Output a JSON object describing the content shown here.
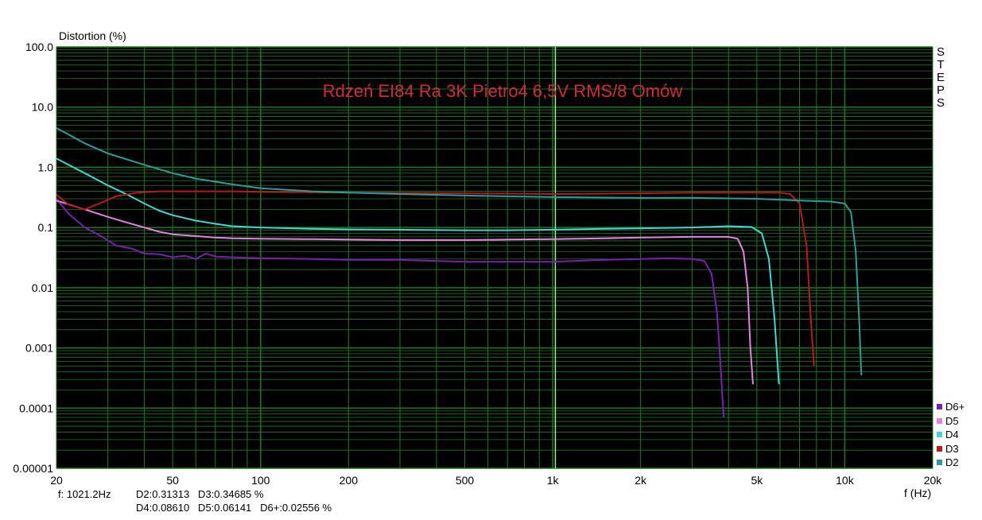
{
  "chart_data": {
    "type": "line",
    "title": "Rdzeń EI84 Ra 3K Pietro4  6,5V RMS/8 Omów",
    "ylabel": "Distortion (%)",
    "xlabel": "f (Hz)",
    "xscale": "log",
    "yscale": "log",
    "xlim": [
      20,
      20000
    ],
    "ylim": [
      1e-05,
      100
    ],
    "x_ticks": [
      {
        "v": 20,
        "label": "20"
      },
      {
        "v": 50,
        "label": "50"
      },
      {
        "v": 100,
        "label": "100"
      },
      {
        "v": 200,
        "label": "200"
      },
      {
        "v": 500,
        "label": "500"
      },
      {
        "v": 1000,
        "label": "1k"
      },
      {
        "v": 2000,
        "label": "2k"
      },
      {
        "v": 5000,
        "label": "5k"
      },
      {
        "v": 10000,
        "label": "10k"
      },
      {
        "v": 20000,
        "label": "20k"
      }
    ],
    "y_ticks": [
      {
        "v": 100,
        "label": "100.0"
      },
      {
        "v": 10,
        "label": "10.0"
      },
      {
        "v": 1,
        "label": "1.0"
      },
      {
        "v": 0.1,
        "label": "0.1"
      },
      {
        "v": 0.01,
        "label": "0.01"
      },
      {
        "v": 0.001,
        "label": "0.001"
      },
      {
        "v": 0.0001,
        "label": "0.0001"
      },
      {
        "v": 1e-05,
        "label": "0.00001"
      }
    ],
    "grid": true,
    "background": "#000000",
    "grid_color": "#1f7a1f",
    "cursor_x": 1021.2,
    "legend_placement": "right-bottom",
    "series": [
      {
        "name": "D6+",
        "color": "#7a1fb5",
        "points": [
          [
            20,
            0.3
          ],
          [
            22,
            0.17
          ],
          [
            25,
            0.1
          ],
          [
            28,
            0.075
          ],
          [
            32,
            0.05
          ],
          [
            36,
            0.045
          ],
          [
            40,
            0.037
          ],
          [
            45,
            0.036
          ],
          [
            50,
            0.032
          ],
          [
            55,
            0.034
          ],
          [
            60,
            0.03
          ],
          [
            65,
            0.037
          ],
          [
            70,
            0.033
          ],
          [
            80,
            0.032
          ],
          [
            100,
            0.031
          ],
          [
            150,
            0.03
          ],
          [
            200,
            0.029
          ],
          [
            300,
            0.029
          ],
          [
            500,
            0.027
          ],
          [
            700,
            0.027
          ],
          [
            1000,
            0.027
          ],
          [
            1500,
            0.029
          ],
          [
            2000,
            0.03
          ],
          [
            2500,
            0.031
          ],
          [
            3000,
            0.03
          ],
          [
            3300,
            0.028
          ],
          [
            3500,
            0.017
          ],
          [
            3650,
            0.004
          ],
          [
            3750,
            0.0006
          ],
          [
            3850,
            7e-05
          ]
        ]
      },
      {
        "name": "D5",
        "color": "#e680e6",
        "points": [
          [
            20,
            0.28
          ],
          [
            25,
            0.2
          ],
          [
            30,
            0.15
          ],
          [
            35,
            0.12
          ],
          [
            40,
            0.1
          ],
          [
            45,
            0.085
          ],
          [
            50,
            0.077
          ],
          [
            60,
            0.072
          ],
          [
            70,
            0.068
          ],
          [
            80,
            0.066
          ],
          [
            100,
            0.065
          ],
          [
            150,
            0.064
          ],
          [
            200,
            0.063
          ],
          [
            300,
            0.062
          ],
          [
            500,
            0.062
          ],
          [
            700,
            0.063
          ],
          [
            1000,
            0.064
          ],
          [
            1500,
            0.066
          ],
          [
            2000,
            0.068
          ],
          [
            3000,
            0.07
          ],
          [
            4000,
            0.07
          ],
          [
            4300,
            0.065
          ],
          [
            4500,
            0.04
          ],
          [
            4650,
            0.01
          ],
          [
            4750,
            0.001
          ],
          [
            4850,
            0.00025
          ]
        ]
      },
      {
        "name": "D4",
        "color": "#3fd6d6",
        "points": [
          [
            20,
            1.4
          ],
          [
            25,
            0.8
          ],
          [
            30,
            0.5
          ],
          [
            35,
            0.35
          ],
          [
            40,
            0.25
          ],
          [
            45,
            0.19
          ],
          [
            50,
            0.16
          ],
          [
            60,
            0.13
          ],
          [
            70,
            0.115
          ],
          [
            80,
            0.105
          ],
          [
            100,
            0.1
          ],
          [
            150,
            0.095
          ],
          [
            200,
            0.093
          ],
          [
            300,
            0.092
          ],
          [
            500,
            0.09
          ],
          [
            700,
            0.09
          ],
          [
            1000,
            0.092
          ],
          [
            1500,
            0.095
          ],
          [
            2000,
            0.097
          ],
          [
            3000,
            0.1
          ],
          [
            4000,
            0.105
          ],
          [
            4800,
            0.102
          ],
          [
            5200,
            0.08
          ],
          [
            5500,
            0.03
          ],
          [
            5750,
            0.003
          ],
          [
            5950,
            0.00025
          ]
        ]
      },
      {
        "name": "D3",
        "color": "#b81a1a",
        "points": [
          [
            20,
            0.35
          ],
          [
            22,
            0.24
          ],
          [
            25,
            0.2
          ],
          [
            28,
            0.25
          ],
          [
            32,
            0.33
          ],
          [
            38,
            0.38
          ],
          [
            45,
            0.4
          ],
          [
            60,
            0.4
          ],
          [
            80,
            0.4
          ],
          [
            100,
            0.39
          ],
          [
            200,
            0.38
          ],
          [
            500,
            0.37
          ],
          [
            1000,
            0.36
          ],
          [
            2000,
            0.37
          ],
          [
            3000,
            0.38
          ],
          [
            4000,
            0.38
          ],
          [
            5000,
            0.38
          ],
          [
            6000,
            0.38
          ],
          [
            6500,
            0.36
          ],
          [
            7000,
            0.25
          ],
          [
            7400,
            0.05
          ],
          [
            7650,
            0.003
          ],
          [
            7850,
            0.0005
          ]
        ]
      },
      {
        "name": "D2",
        "color": "#2a9d9d",
        "points": [
          [
            20,
            4.5
          ],
          [
            25,
            2.5
          ],
          [
            30,
            1.7
          ],
          [
            40,
            1.1
          ],
          [
            50,
            0.8
          ],
          [
            60,
            0.65
          ],
          [
            80,
            0.52
          ],
          [
            100,
            0.45
          ],
          [
            150,
            0.4
          ],
          [
            200,
            0.38
          ],
          [
            300,
            0.36
          ],
          [
            500,
            0.34
          ],
          [
            700,
            0.33
          ],
          [
            1000,
            0.32
          ],
          [
            2000,
            0.31
          ],
          [
            3000,
            0.31
          ],
          [
            5000,
            0.3
          ],
          [
            7000,
            0.28
          ],
          [
            9000,
            0.27
          ],
          [
            10000,
            0.25
          ],
          [
            10500,
            0.18
          ],
          [
            10900,
            0.04
          ],
          [
            11200,
            0.003
          ],
          [
            11400,
            0.00035
          ]
        ]
      }
    ]
  },
  "steps_label": "STEPS",
  "readout": {
    "line1_left": "f: 1021.2Hz",
    "line1_right": "D2:0.31313   D3:0.34685 %",
    "line2": "D4:0.08610   D5:0.06141   D6+:0.02556 %"
  }
}
